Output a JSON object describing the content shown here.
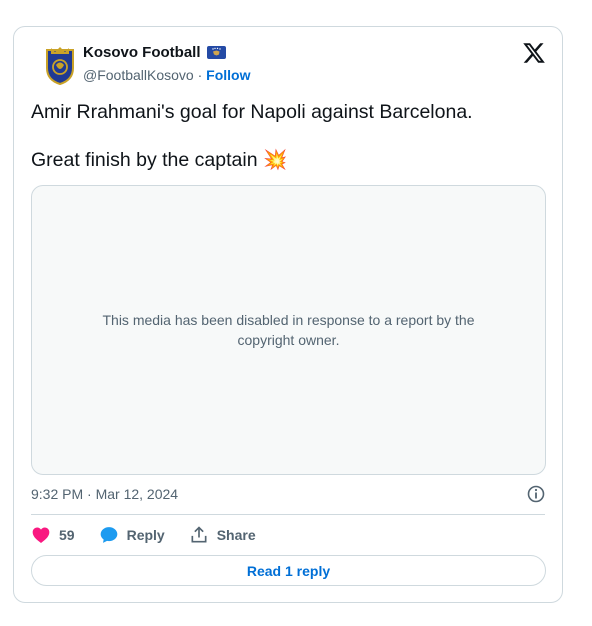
{
  "author": {
    "name": "Kosovo Football",
    "handle": "@FootballKosovo",
    "separator": "·",
    "follow_label": "Follow",
    "avatar_icon": "kosovo-federation-crest",
    "flag_icon": "kosovo-flag"
  },
  "tweet": {
    "line1": "Amir Rrahmani's goal for Napoli against Barcelona.",
    "line2": "Great finish by the captain 💥",
    "media_message": "This media has been disabled in response to a report by the copyright owner.",
    "timestamp": "9:32 PM · Mar 12, 2024"
  },
  "actions": {
    "like_count": "59",
    "reply_label": "Reply",
    "share_label": "Share"
  },
  "read_reply_label": "Read 1 reply",
  "colors": {
    "accent": "#006fd6",
    "like": "#f91880",
    "reply_icon": "#1d9bf0",
    "border": "#cfd9de",
    "muted": "#536471"
  }
}
